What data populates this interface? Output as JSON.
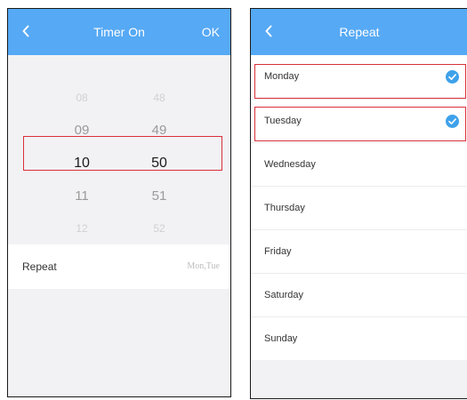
{
  "timer_screen": {
    "header": {
      "back_icon": "chevron-left-icon",
      "title": "Timer On",
      "ok_label": "OK"
    },
    "picker": {
      "hours": [
        "08",
        "09",
        "10",
        "11",
        "12"
      ],
      "minutes": [
        "48",
        "49",
        "50",
        "51",
        "52"
      ],
      "selected_hour": "10",
      "selected_minute": "50"
    },
    "repeat": {
      "label": "Repeat",
      "value": "Mon,Tue"
    }
  },
  "repeat_screen": {
    "header": {
      "back_icon": "chevron-left-icon",
      "title": "Repeat"
    },
    "days": [
      {
        "label": "Monday",
        "checked": true
      },
      {
        "label": "Tuesday",
        "checked": true
      },
      {
        "label": "Wednesday",
        "checked": false
      },
      {
        "label": "Thursday",
        "checked": false
      },
      {
        "label": "Friday",
        "checked": false
      },
      {
        "label": "Saturday",
        "checked": false
      },
      {
        "label": "Sunday",
        "checked": false
      }
    ]
  },
  "colors": {
    "header_blue": "#56a9f4",
    "check_blue": "#3ea1ea",
    "highlight_red": "#d9303a",
    "background_gray": "#f2f2f4"
  }
}
